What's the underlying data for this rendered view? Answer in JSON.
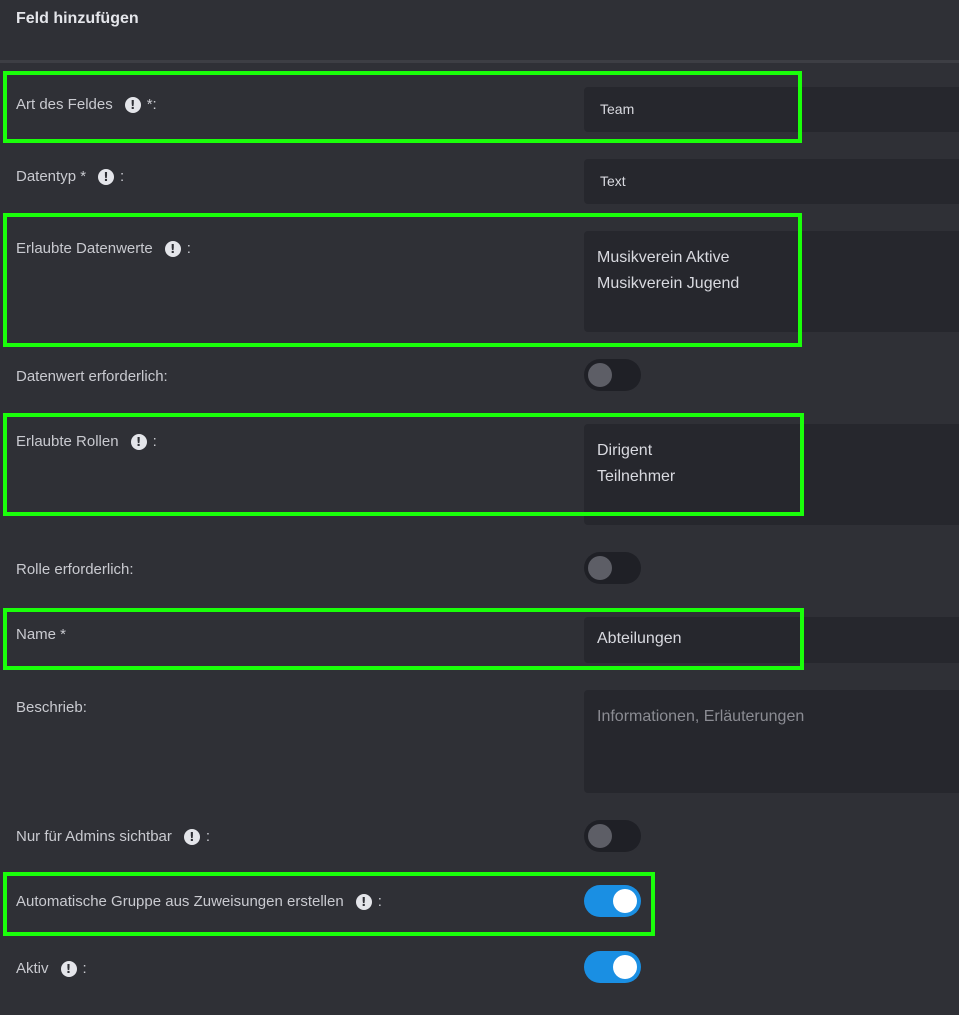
{
  "header": {
    "title": "Feld hinzufügen"
  },
  "fields": {
    "art": {
      "label": "Art des Feldes",
      "suffix": "*:",
      "value": "Team"
    },
    "datentyp": {
      "label": "Datentyp *",
      "suffix": ":",
      "value": "Text"
    },
    "datenwerte": {
      "label": "Erlaubte Datenwerte",
      "suffix": ":",
      "values": [
        "Musikverein Aktive",
        "Musikverein Jugend"
      ]
    },
    "datenwert_required": {
      "label": "Datenwert erforderlich:",
      "on": false
    },
    "rollen": {
      "label": "Erlaubte Rollen",
      "suffix": ":",
      "values": [
        "Dirigent",
        "Teilnehmer"
      ]
    },
    "rolle_required": {
      "label": "Rolle erforderlich:",
      "on": false
    },
    "name": {
      "label": "Name *",
      "value": "Abteilungen"
    },
    "beschrieb": {
      "label": "Beschrieb:",
      "placeholder": "Informationen, Erläuterungen"
    },
    "admins": {
      "label": "Nur für Admins sichtbar",
      "suffix": ":",
      "on": false
    },
    "auto_group": {
      "label": "Automatische Gruppe aus Zuweisungen erstellen",
      "suffix": ":",
      "on": true
    },
    "aktiv": {
      "label": "Aktiv",
      "suffix": ":",
      "on": true
    }
  },
  "icons": {
    "info": "info-exclamation-icon"
  },
  "colors": {
    "background": "#2f3036",
    "field": "#26272d",
    "toggle_on": "#1a8fe3",
    "highlight": "#1aff0a"
  }
}
